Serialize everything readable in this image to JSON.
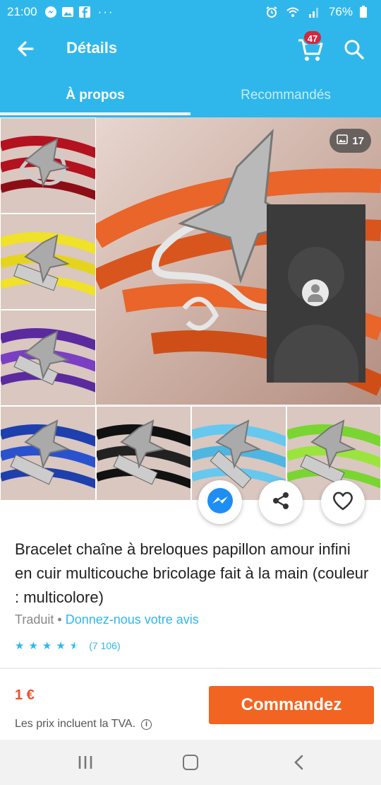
{
  "status_bar": {
    "time": "21:00",
    "ellipsis": "···",
    "battery": "76%",
    "icons": [
      "messenger-icon",
      "gallery-icon",
      "facebook-icon",
      "alarm-icon",
      "wifi-icon",
      "signal-icon",
      "battery-icon"
    ]
  },
  "header": {
    "title": "Détails",
    "cart_count": "47",
    "icons": [
      "back-arrow-icon",
      "cart-icon",
      "search-icon"
    ]
  },
  "tabs": [
    {
      "label": "À propos",
      "active": true
    },
    {
      "label": "Recommandés",
      "active": false
    }
  ],
  "gallery": {
    "photo_count": "17",
    "thumbnail_colors": [
      "#b3121f",
      "#f0e12a",
      "#5b2a9e",
      "#1e3fae",
      "#111111",
      "#66c8ef",
      "#7ad532"
    ],
    "main_color": "#e9652a"
  },
  "actions": {
    "icons": [
      "messenger-share-icon",
      "share-icon",
      "heart-icon"
    ]
  },
  "product": {
    "title": "Bracelet chaîne à breloques papillon amour infini en cuir multicouche bricolage fait à la main (couleur : multicolore)",
    "translated_label": "Traduit",
    "bullet": "•",
    "feedback_link": "Donnez-nous votre avis",
    "rating_value": 4.5,
    "review_count": "(7 106)"
  },
  "purchase": {
    "price": "1 €",
    "vat_note": "Les prix incluent la TVA.",
    "order_button": "Commandez"
  },
  "colors": {
    "primary": "#2fb7ec",
    "order": "#f26422",
    "price": "#e8542a",
    "badge": "#d7263d"
  }
}
